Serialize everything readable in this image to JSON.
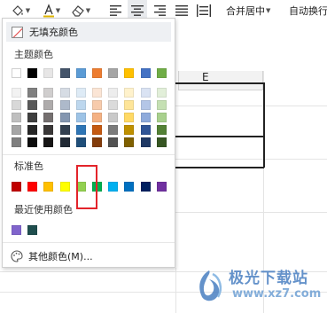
{
  "toolbar": {
    "merge_center_label": "合并居中",
    "auto_wrap_label": "自动换行"
  },
  "sheet": {
    "column_label": "E"
  },
  "color_picker": {
    "no_fill_label": "无填充颜色",
    "theme_colors_label": "主题颜色",
    "standard_colors_label": "标准色",
    "recent_colors_label": "最近使用颜色",
    "more_colors_label": "其他颜色(M)...",
    "theme_top_row": [
      "#ffffff",
      "#000000",
      "#e7e6e6",
      "#44546a",
      "#5b9bd5",
      "#ed7d31",
      "#a5a5a5",
      "#ffc000",
      "#4472c4",
      "#70ad47"
    ],
    "theme_shades": [
      [
        "#f2f2f2",
        "#808080",
        "#d0cece",
        "#d6dce4",
        "#deebf6",
        "#fbe5d5",
        "#ededed",
        "#fff2cc",
        "#dae3f3",
        "#e2efd9"
      ],
      [
        "#d8d8d8",
        "#595959",
        "#aeabab",
        "#adb9ca",
        "#bdd7ee",
        "#f7cbac",
        "#dbdbdb",
        "#fee599",
        "#b4c6e7",
        "#c5e0b3"
      ],
      [
        "#bfbfbf",
        "#3f3f3f",
        "#757070",
        "#8496b0",
        "#9dc3e6",
        "#f4b183",
        "#c9c9c9",
        "#ffd965",
        "#8eaadb",
        "#a8d08d"
      ],
      [
        "#a5a5a5",
        "#262626",
        "#3a3838",
        "#323f4f",
        "#2e75b5",
        "#c55a11",
        "#7b7b7b",
        "#bf9000",
        "#2f5496",
        "#538135"
      ],
      [
        "#7f7f7f",
        "#0c0c0c",
        "#171616",
        "#222a35",
        "#1f4e79",
        "#833c0b",
        "#525252",
        "#7f6000",
        "#1f3864",
        "#375623"
      ]
    ],
    "standard_colors": [
      "#c00000",
      "#ff0000",
      "#ffc000",
      "#ffff00",
      "#92d050",
      "#00b050",
      "#00b0f0",
      "#0070c0",
      "#002060",
      "#7030a0"
    ],
    "recent_colors": [
      "#8064cc",
      "#1f4e4e"
    ]
  },
  "watermark": {
    "brand_text": "极光下载站",
    "url_text": "www.xz7.com"
  }
}
